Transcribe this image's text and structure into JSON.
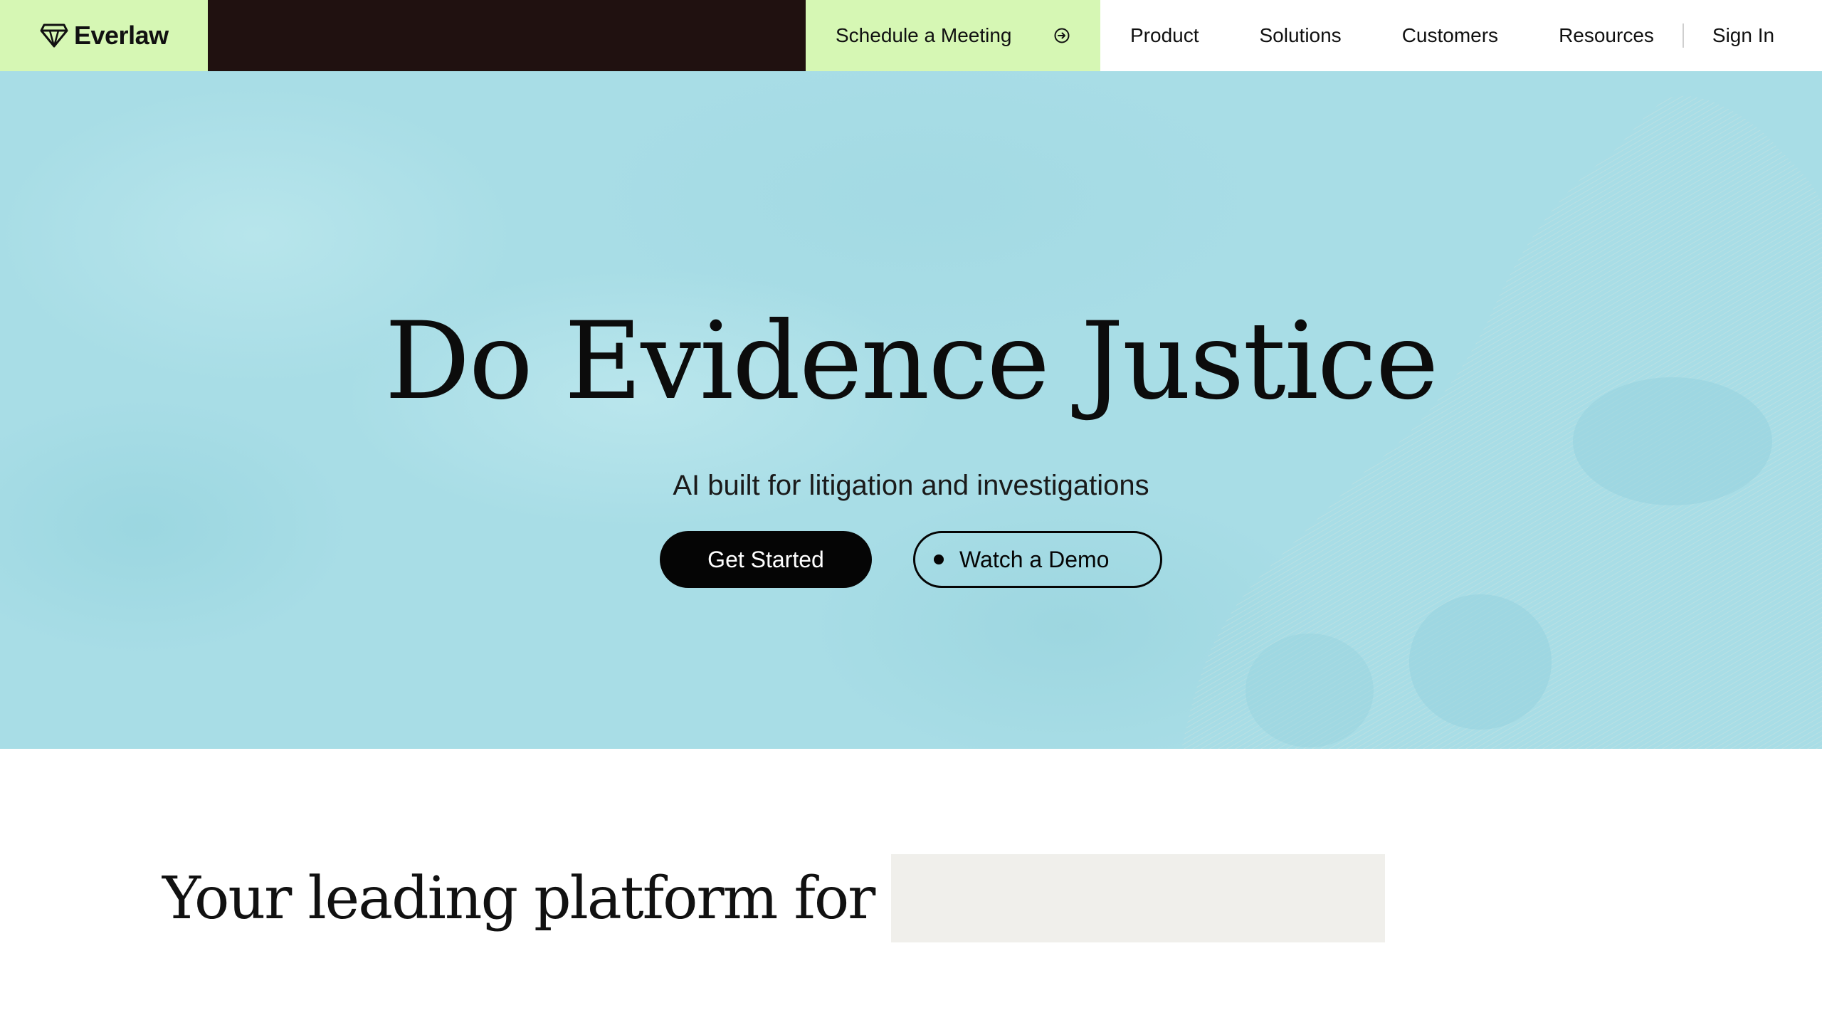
{
  "nav": {
    "brand": "Everlaw",
    "cta_label": "Schedule a Meeting",
    "links": [
      "Product",
      "Solutions",
      "Customers",
      "Resources"
    ],
    "signin": "Sign In"
  },
  "hero": {
    "title": "Do Evidence Justice",
    "subtitle": "AI built for litigation and investigations",
    "primary_button": "Get Started",
    "secondary_button": "Watch a Demo"
  },
  "lower": {
    "lead": "Your leading platform for",
    "rotating_word": ""
  },
  "colors": {
    "brand_green": "#d6f7b4",
    "nav_dark": "#201110",
    "hero_blue": "#a8dde6",
    "button_black": "#050505",
    "placeholder_gray": "#f0efeb"
  },
  "icons": {
    "brand": "diamond-logo-icon",
    "cta": "arrow-circle-right-icon",
    "demo": "dot-icon"
  }
}
